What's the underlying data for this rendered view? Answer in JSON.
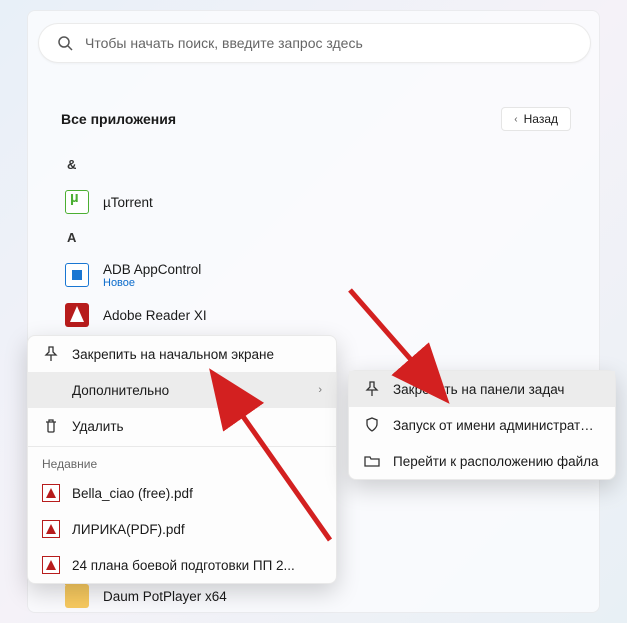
{
  "search": {
    "placeholder": "Чтобы начать поиск, введите запрос здесь"
  },
  "header": {
    "title": "Все приложения",
    "back_label": "Назад"
  },
  "list": {
    "letter_amp": "&",
    "utorrent": "µTorrent",
    "letter_a": "A",
    "adb": {
      "name": "ADB AppControl",
      "badge": "Новое"
    },
    "adobe": "Adobe Reader XI",
    "daum": "Daum PotPlayer x64"
  },
  "menu1": {
    "pin_start": "Закрепить на начальном экране",
    "more": "Дополнительно",
    "delete": "Удалить",
    "recent": "Недавние",
    "file1": "Bella_ciao (free).pdf",
    "file2": "ЛИРИКА(PDF).pdf",
    "file3": "24 плана боевой подготовки ПП 2..."
  },
  "menu2": {
    "pin_taskbar": "Закрепить на панели задач",
    "run_admin": "Запуск от имени администратора",
    "open_location": "Перейти к расположению файла"
  }
}
